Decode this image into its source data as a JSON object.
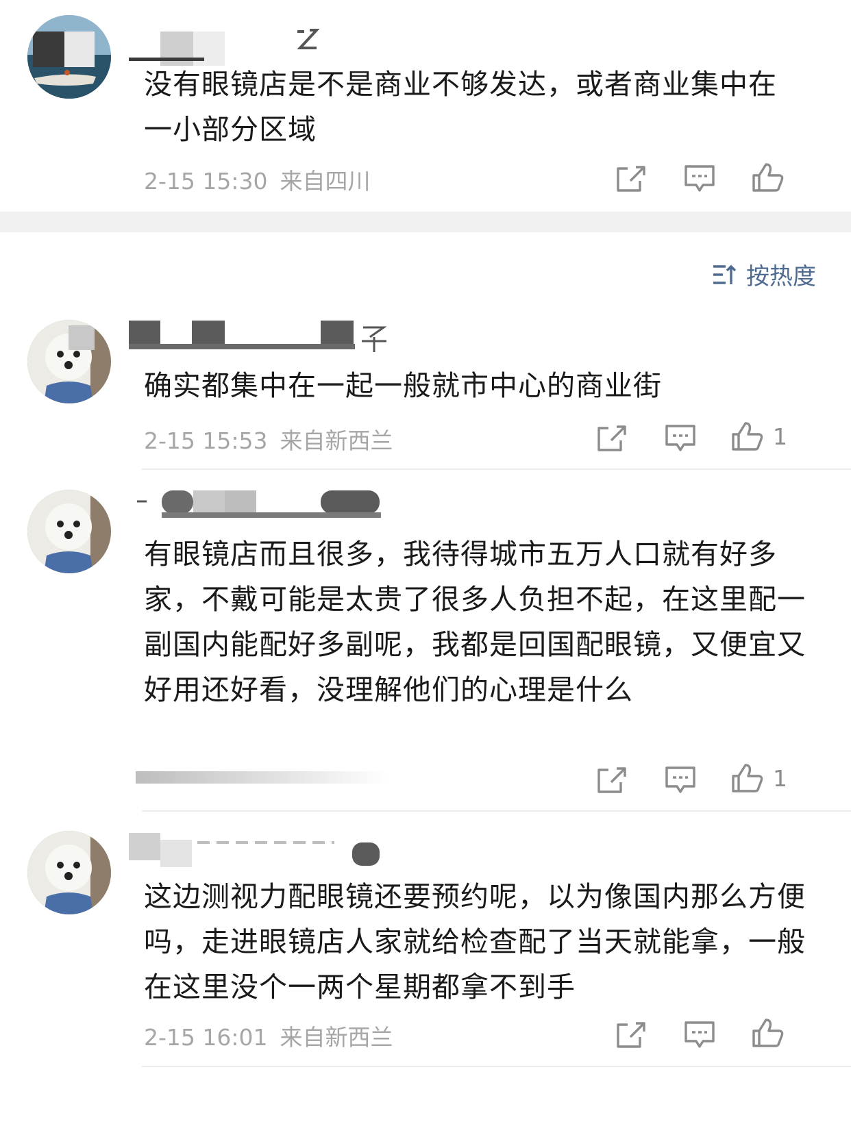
{
  "sort": {
    "label": "按热度"
  },
  "comments": [
    {
      "text": "没有眼镜店是不是商业不够发达，或者商业集中在一小部分区域",
      "date": "2-15 15:30",
      "location": "来自四川",
      "likes": ""
    },
    {
      "text": "确实都集中在一起一般就市中心的商业街",
      "date": "2-15 15:53",
      "location": "来自新西兰",
      "likes": "1"
    },
    {
      "text": "有眼镜店而且很多，我待得城市五万人口就有好多家，不戴可能是太贵了很多人负担不起，在这里配一副国内能配好多副呢，我都是回国配眼镜，又便宜又好用还好看，没理解他们的心理是什么",
      "date": "",
      "location": "",
      "likes": "1"
    },
    {
      "text": "这边测视力配眼镜还要预约呢，以为像国内那么方便吗，走进眼镜店人家就给检查配了当天就能拿，一般在这里没个一两个星期都拿不到手",
      "date": "2-15 16:01",
      "location": "来自新西兰",
      "likes": ""
    }
  ],
  "icons": {
    "share": "share-icon",
    "comment": "comment-icon",
    "like": "thumbs-up-icon",
    "sort": "sort-icon"
  },
  "colors": {
    "text": "#1a1a1a",
    "meta": "#a6a6a6",
    "accent": "#4f6b91",
    "separator": "#f0f0f0"
  }
}
